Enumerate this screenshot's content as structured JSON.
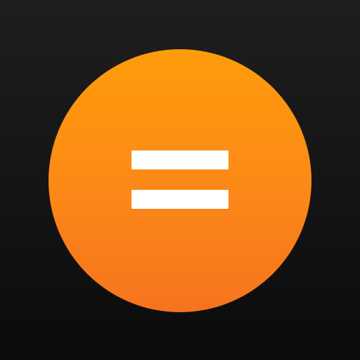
{
  "icon": {
    "name": "equals-icon",
    "symbol": "=",
    "colors": {
      "background_top": "#1e1e1e",
      "background_bottom": "#0b0b0b",
      "circle_top": "#fe9c0a",
      "circle_bottom": "#f7731e",
      "glyph": "#ffffff"
    }
  }
}
